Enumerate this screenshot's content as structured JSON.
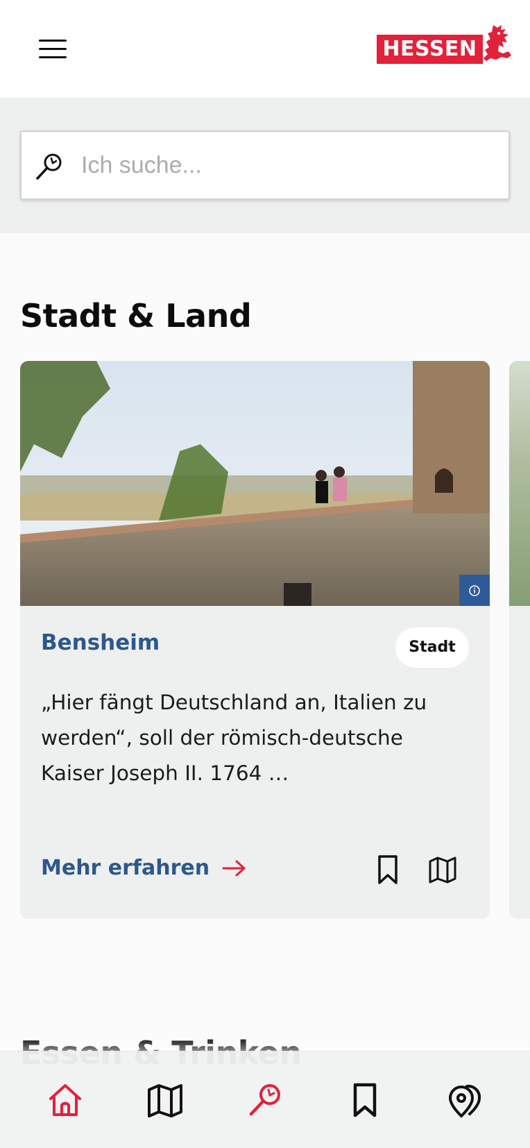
{
  "header": {
    "menu_icon": "hamburger-menu-icon",
    "logo_text": "HESSEN",
    "logo_color": "#e3213b"
  },
  "search": {
    "placeholder": "Ich suche...",
    "icon": "search-icon"
  },
  "sections": [
    {
      "title": "Stadt & Land"
    },
    {
      "title": "Essen & Trinken"
    }
  ],
  "card": {
    "title": "Bensheim",
    "tag": "Stadt",
    "description": "„Hier fängt Deutschland an, Italien zu werden“, soll der römisch-deutsche Kaiser Joseph II. 1764 …",
    "link_label": "Mehr erfahren",
    "link_icon": "arrow-right-icon",
    "info_icon": "info-icon",
    "bookmark_icon": "bookmark-icon",
    "map_icon": "map-icon",
    "accent_color": "#2e578f"
  },
  "bottom_nav": {
    "items": [
      {
        "name": "home",
        "icon": "home-icon",
        "active": true
      },
      {
        "name": "map",
        "icon": "map-icon",
        "active": false
      },
      {
        "name": "search",
        "icon": "search-icon",
        "active": false
      },
      {
        "name": "bookmarks",
        "icon": "bookmark-icon",
        "active": false
      },
      {
        "name": "nearby",
        "icon": "location-pin-icon",
        "active": false
      }
    ]
  }
}
